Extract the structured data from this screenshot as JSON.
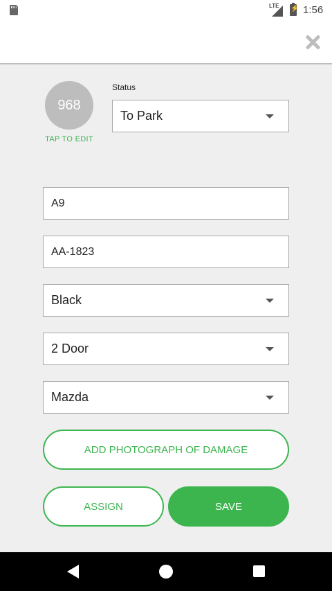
{
  "status_bar": {
    "network": "LTE",
    "time": "1:56"
  },
  "vehicle": {
    "number": "968",
    "tap_to_edit": "TAP TO EDIT"
  },
  "status": {
    "label": "Status",
    "value": "To Park"
  },
  "fields": {
    "space": "A9",
    "plate": "AA-1823",
    "color": "Black",
    "doors": "2 Door",
    "make": "Mazda"
  },
  "buttons": {
    "add_photo": "ADD PHOTOGRAPH OF DAMAGE",
    "assign": "ASSIGN",
    "save": "SAVE"
  },
  "colors": {
    "accent": "#3cb54f",
    "background": "#efefef",
    "avatar": "#bdbdbd"
  },
  "icons": [
    "sd-card-icon",
    "signal-icon",
    "battery-charging-icon",
    "close-icon",
    "dropdown-arrow-icon",
    "back-icon",
    "home-icon",
    "recent-apps-icon"
  ]
}
